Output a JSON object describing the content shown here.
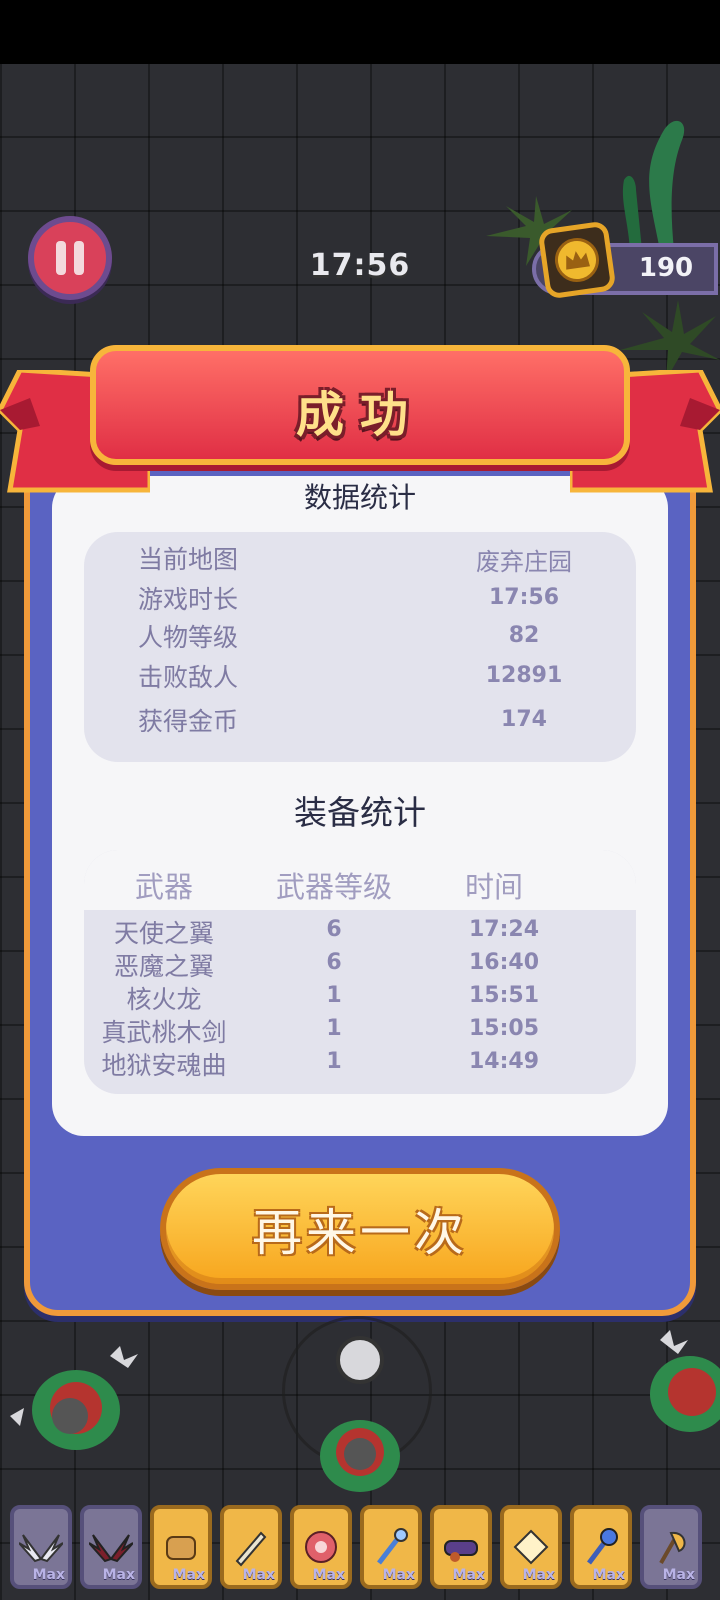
{
  "hud": {
    "timer": "17:56",
    "coins": "190"
  },
  "result": {
    "title": "成功",
    "stats_title": "数据统计",
    "stats": [
      {
        "label": "当前地图",
        "value": "废弃庄园"
      },
      {
        "label": "游戏时长",
        "value": "17:56"
      },
      {
        "label": "人物等级",
        "value": "82"
      },
      {
        "label": "击败敌人",
        "value": "12891"
      },
      {
        "label": "获得金币",
        "value": "174"
      }
    ],
    "equip_title": "装备统计",
    "equip_headers": [
      "武器",
      "武器等级",
      "时间"
    ],
    "equipment": [
      {
        "name": "天使之翼",
        "level": "6",
        "time": "17:24"
      },
      {
        "name": "恶魔之翼",
        "level": "6",
        "time": "16:40"
      },
      {
        "name": "核火龙",
        "level": "1",
        "time": "15:51"
      },
      {
        "name": "真武桃木剑",
        "level": "1",
        "time": "15:05"
      },
      {
        "name": "地狱安魂曲",
        "level": "1",
        "time": "14:49"
      }
    ],
    "retry_label": "再来一次"
  },
  "item_bar": {
    "max_label": "Max",
    "items": [
      {
        "icon": "angel-wings-icon",
        "style": "purple"
      },
      {
        "icon": "demon-wings-icon",
        "style": "purple"
      },
      {
        "icon": "fire-dragon-icon",
        "style": "gold"
      },
      {
        "icon": "peach-sword-icon",
        "style": "gold"
      },
      {
        "icon": "requiem-disc-icon",
        "style": "gold"
      },
      {
        "icon": "staff-icon",
        "style": "gold"
      },
      {
        "icon": "cannon-icon",
        "style": "gold"
      },
      {
        "icon": "crystal-icon",
        "style": "gold"
      },
      {
        "icon": "scepter-icon",
        "style": "gold"
      },
      {
        "icon": "axe-icon",
        "style": "purple"
      }
    ]
  },
  "colors": {
    "panel": "#5a63c2",
    "ribbon": "#e02f45",
    "button": "#f7a51d",
    "accent_border": "#f09a3a"
  }
}
